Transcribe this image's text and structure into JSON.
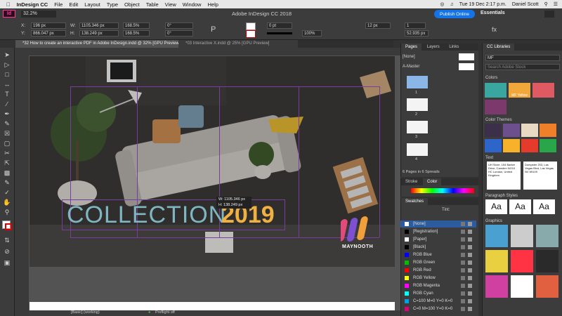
{
  "menubar": {
    "items": [
      "InDesign CC",
      "File",
      "Edit",
      "Layout",
      "Type",
      "Object",
      "Table",
      "View",
      "Window",
      "Help"
    ],
    "clock": "Tue 19 Dec  2:17 p.m.",
    "user": "Daniel Scott"
  },
  "appbar": {
    "badge": "Id",
    "zoom": "32.2%",
    "title": "Adobe InDesign CC 2018",
    "publish_label": "Publish Online",
    "workspace": "Essentials"
  },
  "control": {
    "x_label": "X:",
    "x_value": "196 px",
    "y_label": "Y:",
    "y_value": "866.047 px",
    "w_label": "W:",
    "w_value": "1105.346 px",
    "h_label": "H:",
    "h_value": "138.249 px",
    "scale_x": "168.5%",
    "scale_y": "168.5%",
    "rot": "0°",
    "shear": "0°",
    "stroke_weight": "0 pt",
    "opacity": "100%",
    "col_w": "12 px",
    "col_count": "1",
    "col_h": "52.935 px"
  },
  "tabs": [
    {
      "label": "*32 How to create an interactive PDF in Adobe InDesign.indd @ 32% [GPU Preview]"
    },
    {
      "label": "*03 Interactive X.indd @ 25% [GPU Preview]"
    }
  ],
  "canvas": {
    "headline": "COLLECTION",
    "year": "2019",
    "logo_text": "MAYNOOTH",
    "tooltip_w": "W: 1105.346 px",
    "tooltip_h": "H: 138.249 px"
  },
  "status": {
    "style": "[Basic] (working)",
    "preflight": "Preflight off"
  },
  "pages_panel": {
    "tabs": [
      "Pages",
      "Layers",
      "Links"
    ],
    "none": "[None]",
    "master": "A-Master",
    "page_numbers": [
      "1",
      "2",
      "3",
      "4"
    ],
    "summary": "6 Pages in 6 Spreads"
  },
  "stroke_color": {
    "tabs": [
      "Stroke",
      "Color"
    ]
  },
  "swatches": {
    "title": "Swatches",
    "tint_label": "Tint:",
    "items": [
      {
        "name": "[None]",
        "color": "#ffffff"
      },
      {
        "name": "[Registration]",
        "color": "#000000"
      },
      {
        "name": "[Paper]",
        "color": "#ffffff"
      },
      {
        "name": "[Black]",
        "color": "#000000"
      },
      {
        "name": "RGB Blue",
        "color": "#0000ff"
      },
      {
        "name": "RGB Green",
        "color": "#00c000"
      },
      {
        "name": "RGB Red",
        "color": "#ff0000"
      },
      {
        "name": "RGB Yellow",
        "color": "#ffff00"
      },
      {
        "name": "RGB Magenta",
        "color": "#ff00ff"
      },
      {
        "name": "RGB Cyan",
        "color": "#00ffff"
      },
      {
        "name": "C=100 M=0 Y=0 K=0",
        "color": "#00a0e0"
      },
      {
        "name": "C=0 M=100 Y=0 K=0",
        "color": "#e0007a"
      }
    ]
  },
  "cc_libraries": {
    "title": "CC Libraries",
    "library": "MF",
    "search_placeholder": "Search Adobe Stock",
    "sections": {
      "colors": "Colors",
      "themes": "Color Themes",
      "text": "Text",
      "paragraph": "Paragraph Styles",
      "graphics": "Graphics"
    },
    "color_swatches": [
      "#3aa6a0",
      "#f2a73b",
      "#e05a63",
      "#7b3a6b"
    ],
    "color_chip_label": "MF Yellow",
    "themes": [
      [
        "#3b2f4a",
        "#6c4f8c",
        "#e8d9c2",
        "#f07f2a"
      ],
      [
        "#2d65c8",
        "#f7b12a",
        "#e53b2c",
        "#2aa64a"
      ]
    ],
    "text_items": [
      "UH Store, 154 Barker Drive, Camden NO10 HC London, United Kingdom",
      "Dumpster 203, Las Vegas Blvd, Las Vegas NV 89109"
    ],
    "aa_label": "Aa"
  }
}
